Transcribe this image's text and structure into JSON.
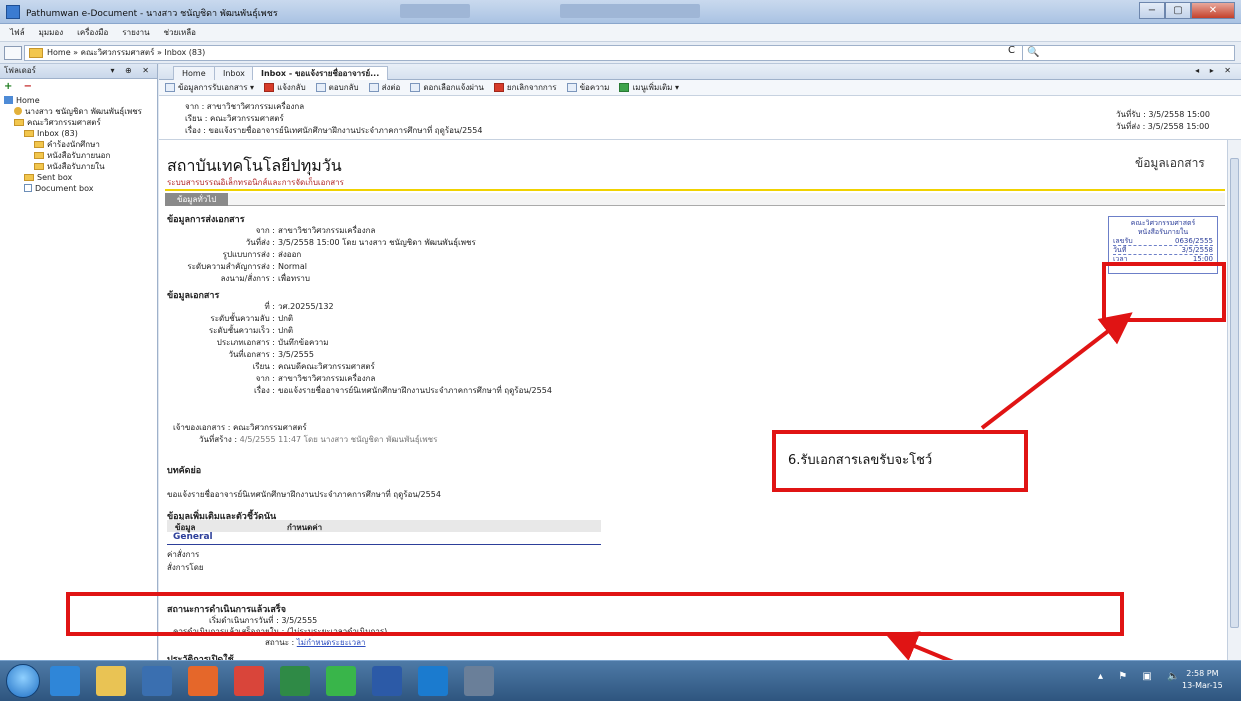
{
  "window": {
    "title": "Pathumwan e-Document - นางสาว ชนัญชิดา พัฒนพันธุ์เพชร"
  },
  "menu": [
    "ไฟล์",
    "มุมมอง",
    "เครื่องมือ",
    "รายงาน",
    "ช่วยเหลือ"
  ],
  "address": {
    "breadcrumb": "Home » คณะวิศวกรรมศาสตร์ » Inbox (83)",
    "refresh": "C",
    "search_icon": "🔍"
  },
  "sidebar": {
    "header": "โฟลเดอร์",
    "controls": "▾ ⊕ ✕",
    "tools": {
      "add": "+",
      "remove": "−"
    },
    "tree": [
      {
        "label": "Home",
        "indent": 0,
        "icon": "home-icon"
      },
      {
        "label": "นางสาว ชนัญชิดา พัฒนพันธุ์เพชร",
        "indent": 1,
        "icon": "person-icon"
      },
      {
        "label": "คณะวิศวกรรมศาสตร์",
        "indent": 1,
        "icon": "folder-icon"
      },
      {
        "label": "Inbox (83)",
        "indent": 2,
        "icon": "folder-icon"
      },
      {
        "label": "คำร้องนักศึกษา",
        "indent": 3,
        "icon": "folder-icon"
      },
      {
        "label": "หนังสือรับภายนอก",
        "indent": 3,
        "icon": "folder-icon"
      },
      {
        "label": "หนังสือรับภายใน",
        "indent": 3,
        "icon": "folder-icon"
      },
      {
        "label": "Sent box",
        "indent": 2,
        "icon": "folder-icon"
      },
      {
        "label": "Document box",
        "indent": 2,
        "icon": "doc-icon"
      }
    ]
  },
  "tabs": [
    {
      "label": "Home",
      "active": false
    },
    {
      "label": "Inbox",
      "active": false
    },
    {
      "label": "Inbox - ขอแจ้งรายชื่ออาจารย์...",
      "active": true
    }
  ],
  "tab_nav": "◂ ▸ ✕",
  "toolbar": [
    {
      "label": "ข้อมูลการรับเอกสาร ▾",
      "icon": "info-icon",
      "color": ""
    },
    {
      "label": "แจ้งกลับ",
      "icon": "pen-icon",
      "color": "red"
    },
    {
      "label": "ตอบกลับ",
      "icon": "reply-icon",
      "color": ""
    },
    {
      "label": "ส่งต่อ",
      "icon": "forward-icon",
      "color": ""
    },
    {
      "label": "ดอกเลือกแจ้งผ่าน",
      "icon": "list-icon",
      "color": ""
    },
    {
      "label": "ยกเลิกจากการ",
      "icon": "cancel-icon",
      "color": "red"
    },
    {
      "label": "ข้อความ",
      "icon": "message-icon",
      "color": ""
    },
    {
      "label": "เมนูเพิ่มเติม ▾",
      "icon": "globe-icon",
      "color": "grn"
    }
  ],
  "message_header": {
    "from": "จาก : สาขาวิชาวิศวกรรมเครื่องกล",
    "to": "เรียน : คณะวิศวกรรมศาสตร์",
    "subject": "เรื่อง : ขอแจ้งรายชื่ออาจารย์นิเทศนักศึกษาฝึกงานประจำภาคการศึกษาที่ ฤดูร้อน/2554",
    "received_date": "วันที่รับ : 3/5/2558 15:00",
    "sent_date": "วันที่ส่ง : 3/5/2558 15:00"
  },
  "document": {
    "institution": "สถาบันเทคโนโลยีปทุมวัน",
    "system_name": "ระบบสารบรรณอิเล็กทรอนิกส์และการจัดเก็บเอกสาร",
    "doc_info_title": "ข้อมูลเอกสาร",
    "general_tab": "ข้อมูลทั่วไป",
    "sending": {
      "title": "ข้อมูลการส่งเอกสาร",
      "rows": [
        {
          "label": "จาก :",
          "value": "สาขาวิชาวิศวกรรมเครื่องกล"
        },
        {
          "label": "วันที่ส่ง :",
          "value": "3/5/2558 15:00 โดย นางสาว ชนัญชิดา พัฒนพันธุ์เพชร"
        },
        {
          "label": "รูปแบบการส่ง :",
          "value": "ส่งออก"
        },
        {
          "label": "ระดับความสำคัญการส่ง :",
          "value": "Normal"
        },
        {
          "label": "ลงนาม/สั่งการ :",
          "value": "เพื่อทราบ"
        }
      ]
    },
    "docinfo": {
      "title": "ข้อมูลเอกสาร",
      "rows": [
        {
          "label": "ที่ :",
          "value": "วศ.20255/132"
        },
        {
          "label": "ระดับชั้นความลับ :",
          "value": "ปกติ"
        },
        {
          "label": "ระดับชั้นความเร็ว :",
          "value": "ปกติ"
        },
        {
          "label": "ประเภทเอกสาร :",
          "value": "บันทึกข้อความ"
        },
        {
          "label": "วันที่เอกสาร :",
          "value": "3/5/2555"
        },
        {
          "label": "เรียน :",
          "value": "คณบดีคณะวิศวกรรมศาสตร์"
        },
        {
          "label": "จาก :",
          "value": "สาขาวิชาวิศวกรรมเครื่องกล"
        },
        {
          "label": "เรื่อง :",
          "value": "ขอแจ้งรายชื่ออาจารย์นิเทศนักศึกษาฝึกงานประจำภาคการศึกษาที่ ฤดูร้อน/2554"
        }
      ]
    },
    "owner": {
      "label": "เจ้าของเอกสาร :",
      "value": "คณะวิศวกรรมศาสตร์"
    },
    "created": {
      "label": "วันที่สร้าง :",
      "value": "4/5/2555 11:47 โดย นางสาว ชนัญชิดา พัฒนพันธุ์เพชร"
    },
    "summary_title": "บทคัดย่อ",
    "summary_text": "ขอแจ้งรายชื่ออาจารย์นิเทศนักศึกษาฝึกงานประจำภาคการศึกษาที่ ฤดูร้อน/2554",
    "extra_title": "ข้อมูลเพิ่มเติมและตัวชี้วัดนัน",
    "extra_table": {
      "headers": [
        "ข้อมูล",
        "กำหนดค่า"
      ],
      "group": "General",
      "rows": [
        "ค่าสั่งการ",
        "สั่งการโดย"
      ]
    },
    "status": {
      "title": "สถานะการดำเนินการแล้วเสร็จ",
      "start": "เริ่มดำเนินการวันที่ : 3/5/2555",
      "deadline": "ควรดำเนินการแล้วเสร็จภายใน : (ไม่ระบุระยะเวลาดำเนินการ)",
      "state_label": "สถานะ :",
      "state_value": "ไม่กำหนดระยะเวลา"
    },
    "history_title": "ประวัติการเปิดใช้",
    "stamp": {
      "org": "คณะวิศวกรรมศาสตร์",
      "type": "หนังสือรับภายใน",
      "rows": [
        {
          "label": "เลขรับ",
          "value": "0636/2555"
        },
        {
          "label": "วันที่",
          "value": "3/5/2558"
        },
        {
          "label": "เวลา",
          "value": "15:00"
        }
      ]
    }
  },
  "annotation": {
    "callout_text": "6.รับเอกสารเลขรับจะโชว์",
    "color": "#e01414"
  },
  "taskbar": {
    "tray": "▴ ⚑ ▣ 🔈",
    "time": "2:58 PM",
    "date": "13-Mar-15",
    "apps": [
      {
        "name": "ie-icon",
        "color": "#2f86d8"
      },
      {
        "name": "explorer-icon",
        "color": "#e9c354"
      },
      {
        "name": "media-icon",
        "color": "#3a6fb0"
      },
      {
        "name": "firefox-icon",
        "color": "#e5672a"
      },
      {
        "name": "chrome-icon",
        "color": "#d9453a"
      },
      {
        "name": "excel-icon",
        "color": "#2f8a46"
      },
      {
        "name": "line-icon",
        "color": "#39b54a"
      },
      {
        "name": "word-icon",
        "color": "#2c5aa7"
      },
      {
        "name": "hp-icon",
        "color": "#1b7bcf"
      },
      {
        "name": "app-icon",
        "color": "#6a7f99"
      }
    ]
  }
}
